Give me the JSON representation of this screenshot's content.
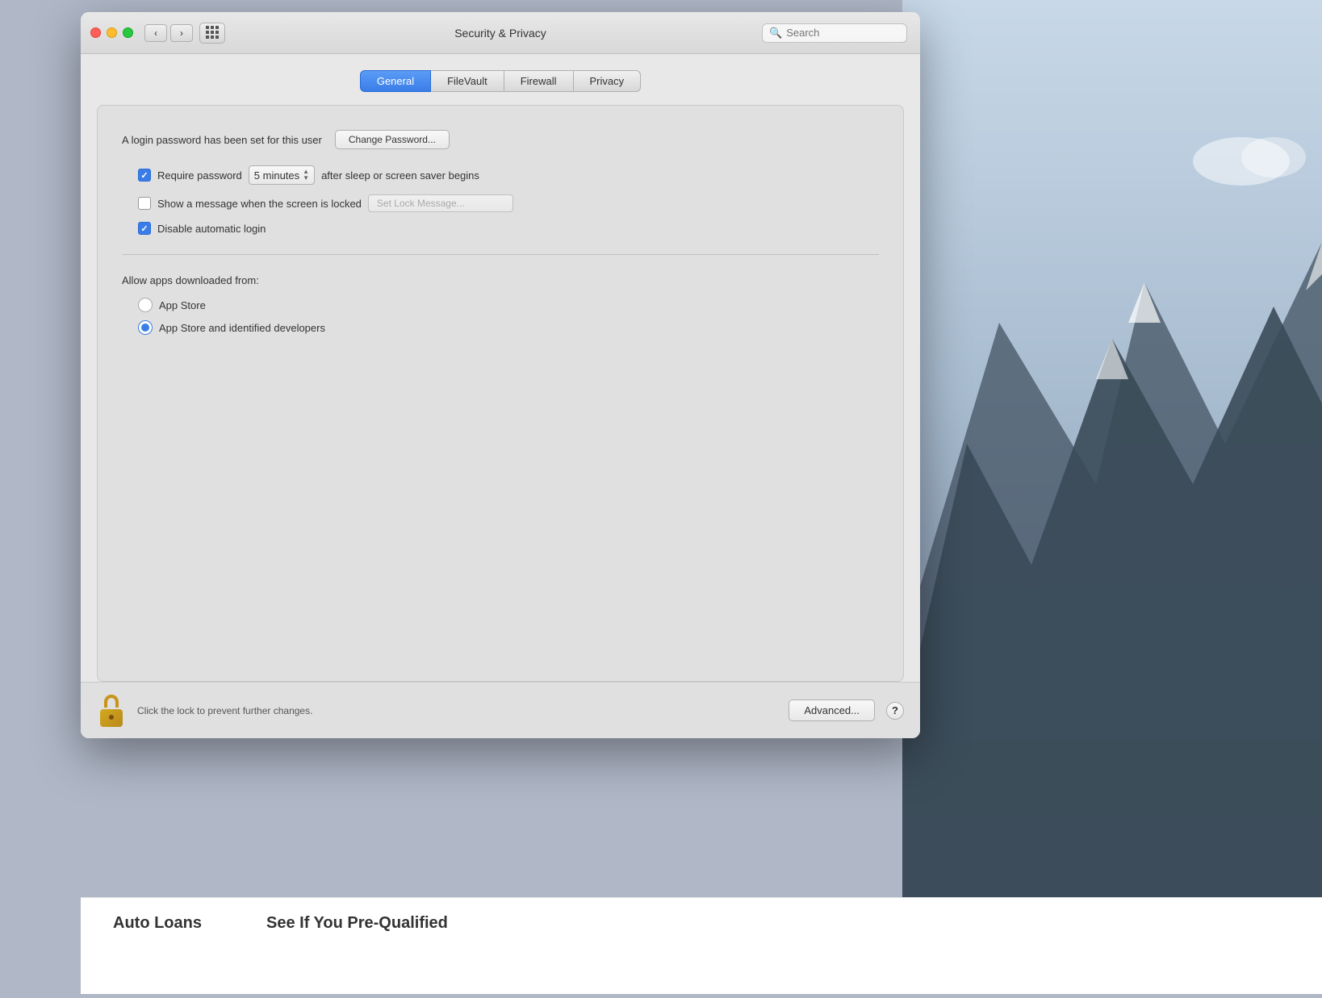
{
  "window": {
    "title": "Security & Privacy",
    "search_placeholder": "Search"
  },
  "tabs": [
    {
      "id": "general",
      "label": "General",
      "active": true
    },
    {
      "id": "filevault",
      "label": "FileVault",
      "active": false
    },
    {
      "id": "firewall",
      "label": "Firewall",
      "active": false
    },
    {
      "id": "privacy",
      "label": "Privacy",
      "active": false
    }
  ],
  "general": {
    "login_password_text": "A login password has been set for this user",
    "change_password_label": "Change Password...",
    "require_password": {
      "checked": true,
      "label_prefix": "Require password",
      "dropdown_value": "5 minutes",
      "label_suffix": "after sleep or screen saver begins"
    },
    "show_message": {
      "checked": false,
      "label": "Show a message when the screen is locked",
      "input_placeholder": "Set Lock Message..."
    },
    "disable_auto_login": {
      "checked": true,
      "label": "Disable automatic login"
    }
  },
  "download_section": {
    "title": "Allow apps downloaded from:",
    "options": [
      {
        "id": "app-store",
        "label": "App Store",
        "selected": false
      },
      {
        "id": "app-store-identified",
        "label": "App Store and identified developers",
        "selected": true
      }
    ]
  },
  "bottom_bar": {
    "lock_status": "Click the lock to prevent further changes.",
    "advanced_label": "Advanced...",
    "help_label": "?"
  },
  "bottom_partial": {
    "left_text": "Auto Loans",
    "right_text": "See If You Pre-Qualified"
  }
}
